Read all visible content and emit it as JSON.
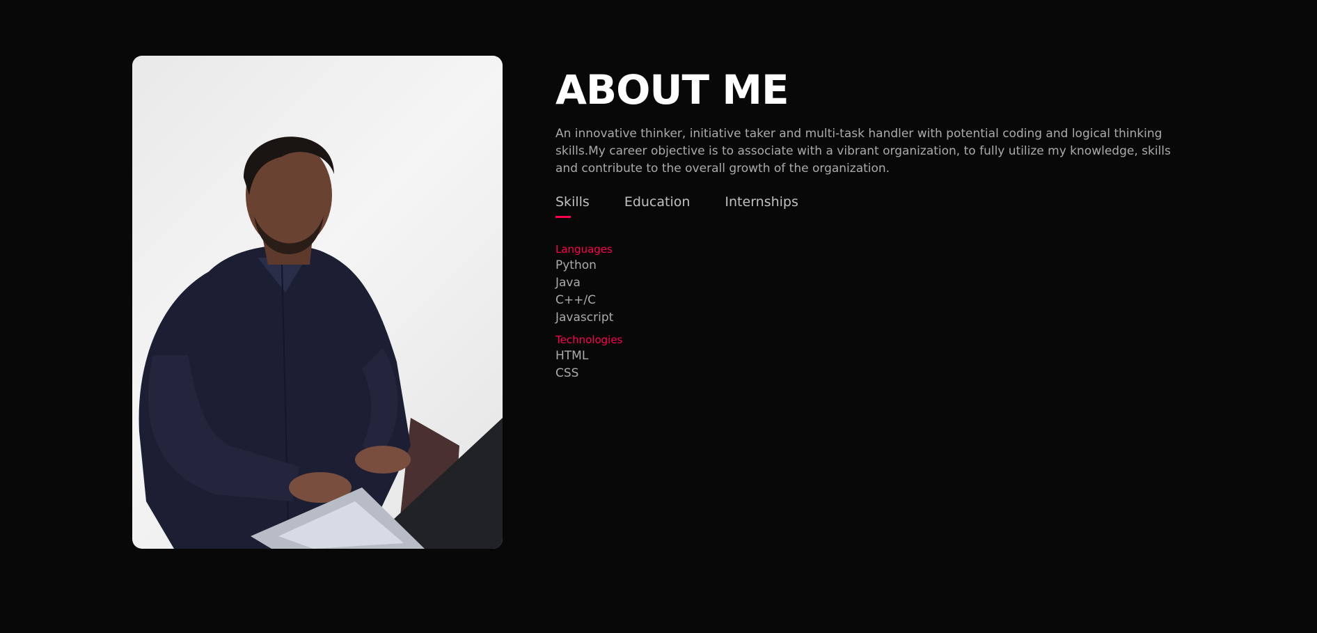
{
  "about": {
    "title": "ABOUT ME",
    "intro": "An innovative thinker, initiative taker and multi-task handler with potential coding and logical thinking skills.My career objective is to associate with a vibrant organization, to fully utilize my knowledge, skills and contribute to the overall growth of the organization."
  },
  "tabs": [
    {
      "label": "Skills",
      "active": true
    },
    {
      "label": "Education",
      "active": false
    },
    {
      "label": "Internships",
      "active": false
    }
  ],
  "skills": {
    "languages": {
      "title": "Languages",
      "items": [
        "Python",
        "Java",
        "C++/C",
        "Javascript"
      ]
    },
    "technologies": {
      "title": "Technologies",
      "items": [
        "HTML",
        "CSS"
      ]
    }
  },
  "colors": {
    "background": "#080808",
    "accent": "#ff004f",
    "heading": "#ffffff",
    "text": "#ababab"
  }
}
